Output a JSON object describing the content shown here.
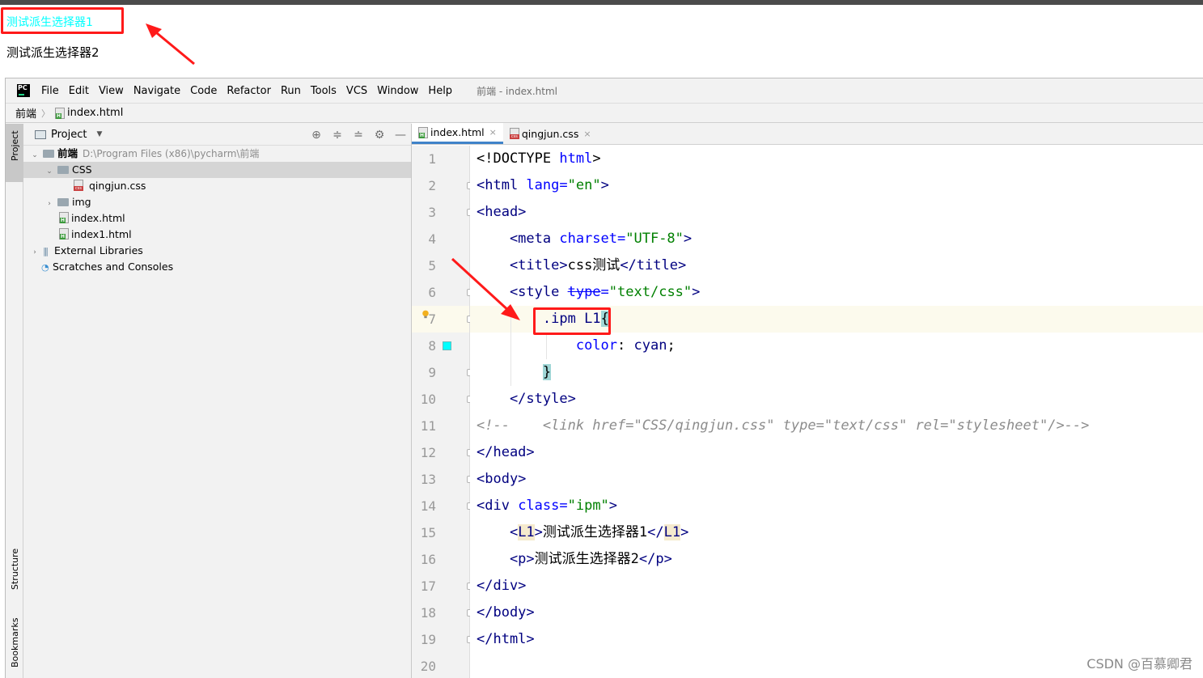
{
  "browser_output": {
    "line1": "测试派生选择器1",
    "line2": "测试派生选择器2",
    "line1_color": "#00ffff"
  },
  "ide": {
    "menu": [
      "File",
      "Edit",
      "View",
      "Navigate",
      "Code",
      "Refactor",
      "Run",
      "Tools",
      "VCS",
      "Window",
      "Help"
    ],
    "window_title": "前端 - index.html",
    "breadcrumb": {
      "project": "前端",
      "file": "index.html"
    },
    "left_strip": {
      "project": "Project",
      "structure": "Structure",
      "bookmarks": "Bookmarks"
    },
    "project_panel": {
      "title": "Project",
      "tree": [
        {
          "label": "前端",
          "extra": "D:\\Program Files (x86)\\pycharm\\前端",
          "type": "folder"
        },
        {
          "label": "CSS",
          "type": "folder"
        },
        {
          "label": "qingjun.css",
          "type": "css"
        },
        {
          "label": "img",
          "type": "folder"
        },
        {
          "label": "index.html",
          "type": "html"
        },
        {
          "label": "index1.html",
          "type": "html"
        },
        {
          "label": "External Libraries",
          "type": "lib"
        },
        {
          "label": "Scratches and Consoles",
          "type": "scratch"
        }
      ]
    },
    "tabs": [
      {
        "label": "index.html",
        "active": true
      },
      {
        "label": "qingjun.css",
        "active": false
      }
    ],
    "line_numbers": [
      "1",
      "2",
      "3",
      "4",
      "5",
      "6",
      "7",
      "8",
      "9",
      "10",
      "11",
      "12",
      "13",
      "14",
      "15",
      "16",
      "17",
      "18",
      "19",
      "20"
    ],
    "code": {
      "l1": {
        "p1": "<!DOCTYPE ",
        "p2": "html",
        "p3": ">"
      },
      "l2": {
        "p1": "<html ",
        "p2": "lang=",
        "p3": "\"en\"",
        "p4": ">"
      },
      "l3": {
        "p1": "<head>"
      },
      "l4": {
        "p1": "    <meta ",
        "p2": "charset=",
        "p3": "\"UTF-8\"",
        "p4": ">"
      },
      "l5": {
        "p1": "    <title>",
        "p2": "css测试",
        "p3": "</title>"
      },
      "l6": {
        "p1": "    <style ",
        "p2": "type",
        "p3": "=",
        "p4": "\"text/css\"",
        "p5": ">"
      },
      "l7": {
        "p1": "        .ipm ",
        "p2": "L1",
        "p3": "{"
      },
      "l8": {
        "p1": "            ",
        "p2": "color",
        "p3": ": ",
        "p4": "cyan",
        "p5": ";"
      },
      "l9": {
        "p1": "        ",
        "p2": "}"
      },
      "l10": {
        "p1": "    </style>"
      },
      "l11": {
        "p1": "<!--    <link href=\"CSS/qingjun.css\" type=\"text/css\" rel=\"stylesheet\"/>-->"
      },
      "l12": {
        "p1": "</head>"
      },
      "l13": {
        "p1": "<body>"
      },
      "l14": {
        "p1": "<div ",
        "p2": "class=",
        "p3": "\"ipm\"",
        "p4": ">"
      },
      "l15": {
        "p1": "    <",
        "p2": "L1",
        "p3": ">",
        "p4": "测试派生选择器1",
        "p5": "</",
        "p6": "L1",
        "p7": ">"
      },
      "l16": {
        "p1": "    <p>",
        "p2": "测试派生选择器2",
        "p3": "</p>"
      },
      "l17": {
        "p1": "</div>"
      },
      "l18": {
        "p1": "</body>"
      },
      "l19": {
        "p1": "</html>"
      }
    },
    "watermark": "CSDN @百慕卿君"
  }
}
